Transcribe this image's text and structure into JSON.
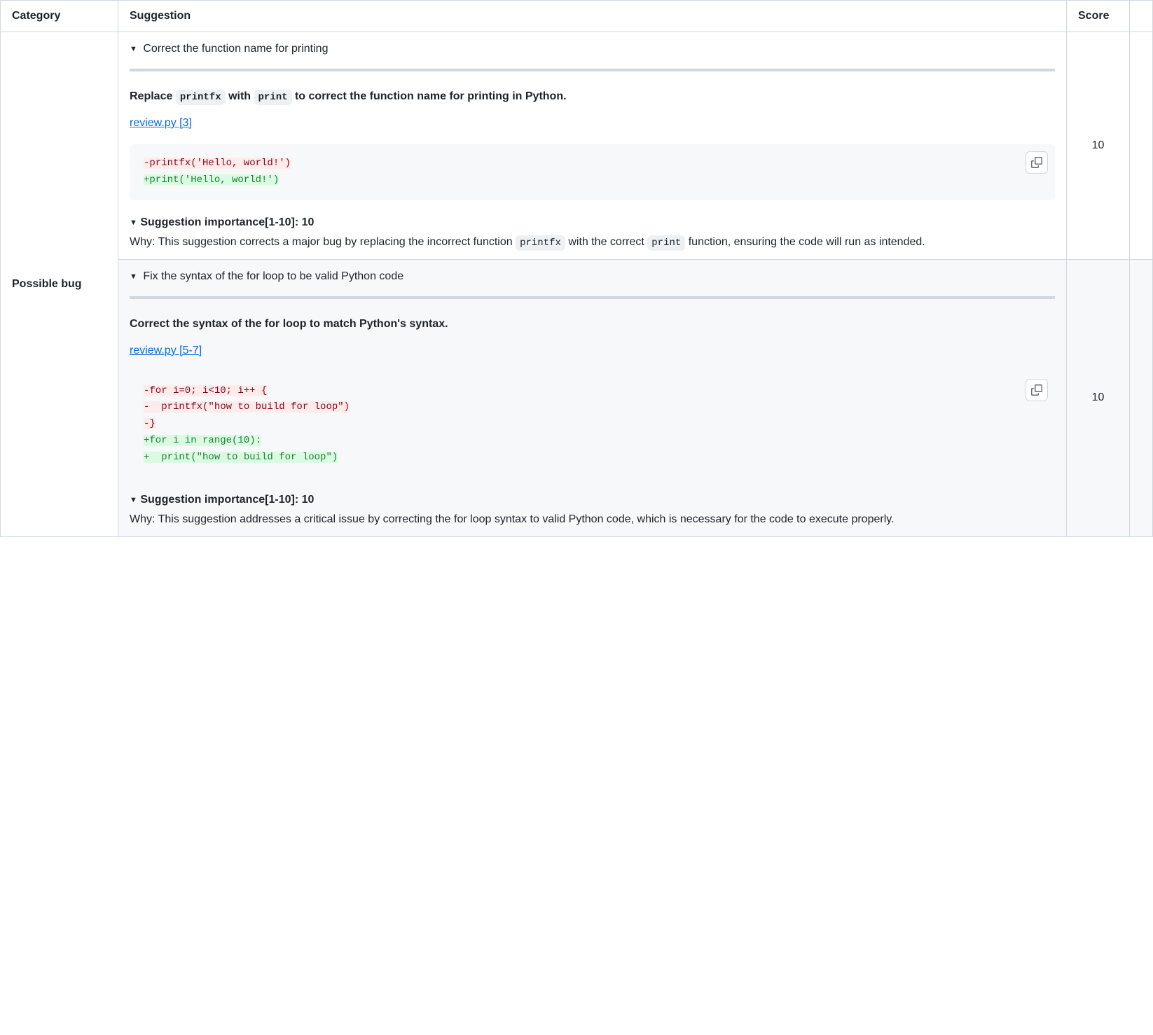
{
  "headers": {
    "category": "Category",
    "suggestion": "Suggestion",
    "score": "Score"
  },
  "category": "Possible bug",
  "rows": [
    {
      "title": "Correct the function name for printing",
      "desc_parts": [
        "Replace ",
        "printfx",
        " with ",
        "print",
        " to correct the function name for printing in Python."
      ],
      "file": "review.py [3]",
      "code": [
        {
          "kind": "del",
          "text": "-printfx('Hello, world!')"
        },
        {
          "kind": "add",
          "text": "+print('Hello, world!')"
        }
      ],
      "importance_title": "Suggestion importance[1-10]: 10",
      "why_parts": [
        "Why: This suggestion corrects a major bug by replacing the incorrect function ",
        "printfx",
        " with the correct ",
        "print",
        " function, ensuring the code will run as intended."
      ],
      "score": "10"
    },
    {
      "title": "Fix the syntax of the for loop to be valid Python code",
      "desc_plain": "Correct the syntax of the for loop to match Python's syntax.",
      "file": "review.py [5-7]",
      "code": [
        {
          "kind": "del",
          "text": "-for i=0; i<10; i++ {"
        },
        {
          "kind": "del",
          "text": "-  printfx(\"how to build for loop\")"
        },
        {
          "kind": "del",
          "text": "-}"
        },
        {
          "kind": "add",
          "text": "+for i in range(10):"
        },
        {
          "kind": "add",
          "text": "+  print(\"how to build for loop\")"
        }
      ],
      "importance_title": "Suggestion importance[1-10]: 10",
      "why_plain": "Why: This suggestion addresses a critical issue by correcting the for loop syntax to valid Python code, which is necessary for the code to execute properly.",
      "score": "10"
    }
  ]
}
